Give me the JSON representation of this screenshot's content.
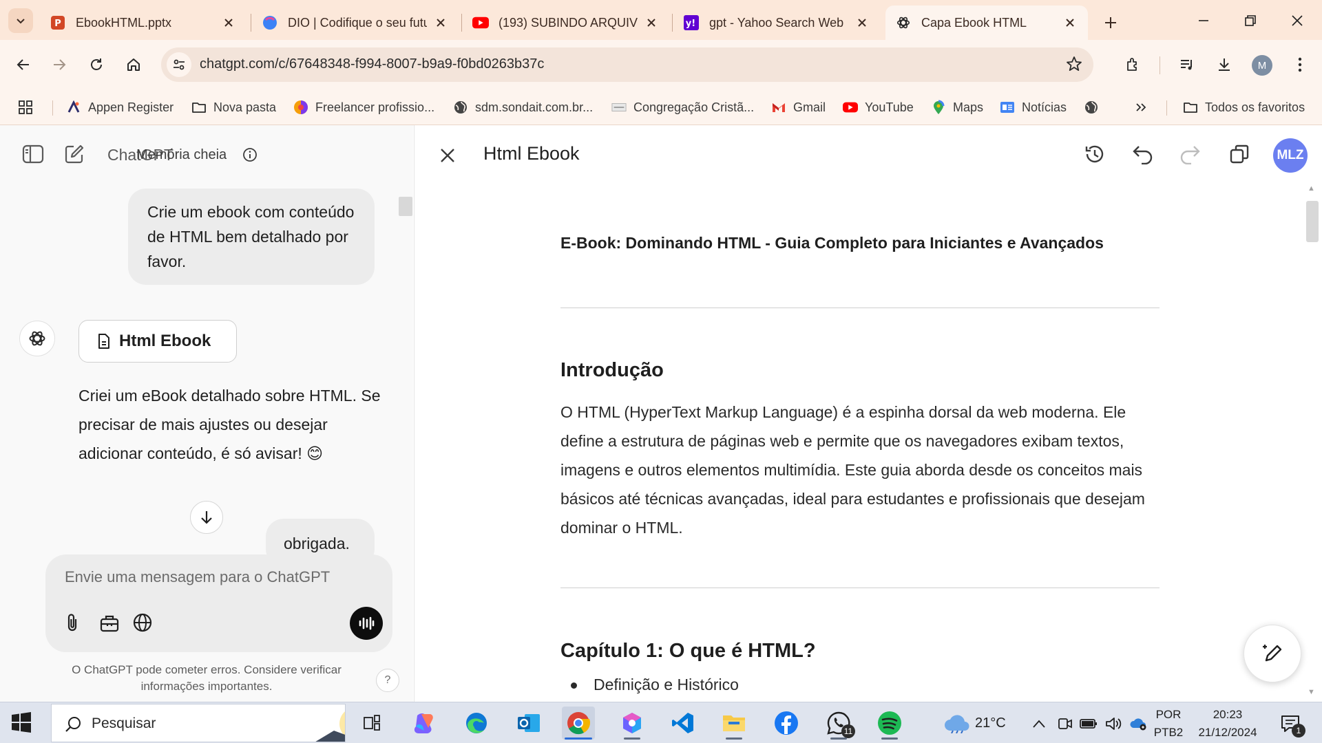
{
  "browser": {
    "tabs": [
      {
        "title": "EbookHTML.pptx",
        "icon": "powerpoint-icon"
      },
      {
        "title": "DIO | Codifique o seu futuro",
        "icon": "dio-icon"
      },
      {
        "title": "(193) SUBINDO ARQUIVOS",
        "icon": "youtube-icon"
      },
      {
        "title": "gpt - Yahoo Search Web",
        "icon": "yahoo-icon"
      },
      {
        "title": "Capa Ebook HTML",
        "icon": "chatgpt-icon",
        "active": true
      }
    ],
    "url": "chatgpt.com/c/67648348-f994-8007-b9a9-f0bd0263b37c",
    "profile_initial": "M",
    "bookmarks": [
      {
        "label": "Appen Register",
        "icon": "appen-icon"
      },
      {
        "label": "Nova pasta",
        "icon": "folder-icon"
      },
      {
        "label": "Freelancer profissio...",
        "icon": "freelancer-icon"
      },
      {
        "label": "sdm.sondait.com.br...",
        "icon": "globe-icon"
      },
      {
        "label": "Congregação Cristã...",
        "icon": "ccb-icon"
      },
      {
        "label": "Gmail",
        "icon": "gmail-icon"
      },
      {
        "label": "YouTube",
        "icon": "youtube-icon"
      },
      {
        "label": "Maps",
        "icon": "maps-icon"
      },
      {
        "label": "Notícias",
        "icon": "news-icon"
      }
    ],
    "all_bookmarks_label": "Todos os favoritos"
  },
  "chat": {
    "brand": "ChatGPT",
    "memory_label": "Memória cheia",
    "user_message_1": "Crie um ebook com conteúdo de HTML bem detalhado por favor.",
    "doc_card_label": "Html Ebook",
    "assistant_message": "Criei um eBook detalhado sobre HTML. Se precisar de mais ajustes ou desejar adicionar conteúdo, é só avisar! 😊",
    "user_message_2": "obrigada.",
    "composer_placeholder": "Envie uma mensagem para o ChatGPT",
    "disclaimer": "O ChatGPT pode cometer erros. Considere verificar informações importantes.",
    "help_label": "?"
  },
  "canvas": {
    "title": "Html Ebook",
    "avatar_initials": "MLZ",
    "doc_title": "E-Book: Dominando HTML - Guia Completo para Iniciantes e Avançados",
    "intro_heading": "Introdução",
    "intro_text": "O HTML (HyperText Markup Language) é a espinha dorsal da web moderna. Ele define a estrutura de páginas web e permite que os navegadores exibam textos, imagens e outros elementos multimídia. Este guia aborda desde os conceitos mais básicos até técnicas avançadas, ideal para estudantes e profissionais que desejam dominar o HTML.",
    "chapter1_heading": "Capítulo 1: O que é HTML?",
    "chapter1_item1": "Definição e Histórico"
  },
  "taskbar": {
    "search_placeholder": "Pesquisar",
    "weather_temp": "21°C",
    "lang_1": "POR",
    "lang_2": "PTB2",
    "time": "20:23",
    "date": "21/12/2024",
    "whatsapp_badge": "11",
    "notification_badge": "1"
  },
  "colors": {
    "tabstrip_bg": "#fce8da",
    "toolbar_bg": "#fdf4ee",
    "canvas_avatar": "#6b7ff0",
    "taskbar_bg": "#dfe4ee"
  }
}
